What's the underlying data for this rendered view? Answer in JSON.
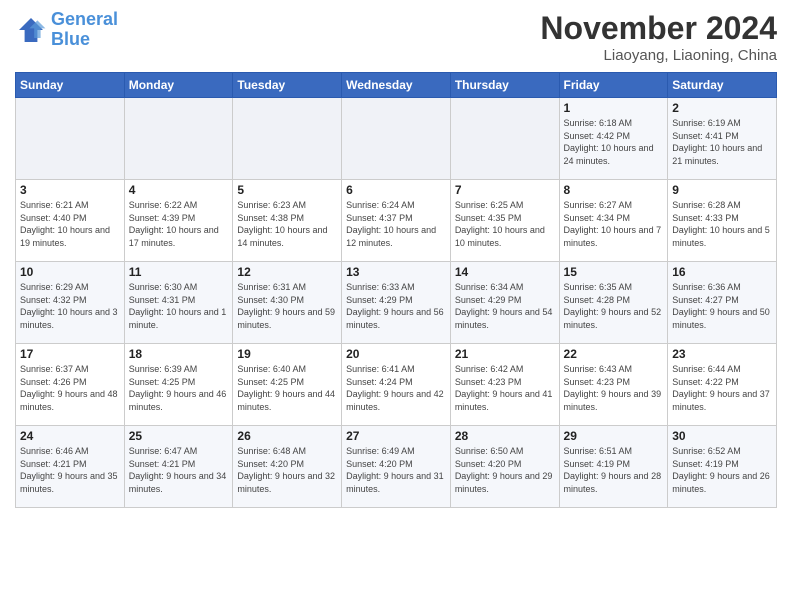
{
  "header": {
    "logo_line1": "General",
    "logo_line2": "Blue",
    "month": "November 2024",
    "location": "Liaoyang, Liaoning, China"
  },
  "weekdays": [
    "Sunday",
    "Monday",
    "Tuesday",
    "Wednesday",
    "Thursday",
    "Friday",
    "Saturday"
  ],
  "weeks": [
    [
      {
        "day": "",
        "info": ""
      },
      {
        "day": "",
        "info": ""
      },
      {
        "day": "",
        "info": ""
      },
      {
        "day": "",
        "info": ""
      },
      {
        "day": "",
        "info": ""
      },
      {
        "day": "1",
        "info": "Sunrise: 6:18 AM\nSunset: 4:42 PM\nDaylight: 10 hours and 24 minutes."
      },
      {
        "day": "2",
        "info": "Sunrise: 6:19 AM\nSunset: 4:41 PM\nDaylight: 10 hours and 21 minutes."
      }
    ],
    [
      {
        "day": "3",
        "info": "Sunrise: 6:21 AM\nSunset: 4:40 PM\nDaylight: 10 hours and 19 minutes."
      },
      {
        "day": "4",
        "info": "Sunrise: 6:22 AM\nSunset: 4:39 PM\nDaylight: 10 hours and 17 minutes."
      },
      {
        "day": "5",
        "info": "Sunrise: 6:23 AM\nSunset: 4:38 PM\nDaylight: 10 hours and 14 minutes."
      },
      {
        "day": "6",
        "info": "Sunrise: 6:24 AM\nSunset: 4:37 PM\nDaylight: 10 hours and 12 minutes."
      },
      {
        "day": "7",
        "info": "Sunrise: 6:25 AM\nSunset: 4:35 PM\nDaylight: 10 hours and 10 minutes."
      },
      {
        "day": "8",
        "info": "Sunrise: 6:27 AM\nSunset: 4:34 PM\nDaylight: 10 hours and 7 minutes."
      },
      {
        "day": "9",
        "info": "Sunrise: 6:28 AM\nSunset: 4:33 PM\nDaylight: 10 hours and 5 minutes."
      }
    ],
    [
      {
        "day": "10",
        "info": "Sunrise: 6:29 AM\nSunset: 4:32 PM\nDaylight: 10 hours and 3 minutes."
      },
      {
        "day": "11",
        "info": "Sunrise: 6:30 AM\nSunset: 4:31 PM\nDaylight: 10 hours and 1 minute."
      },
      {
        "day": "12",
        "info": "Sunrise: 6:31 AM\nSunset: 4:30 PM\nDaylight: 9 hours and 59 minutes."
      },
      {
        "day": "13",
        "info": "Sunrise: 6:33 AM\nSunset: 4:29 PM\nDaylight: 9 hours and 56 minutes."
      },
      {
        "day": "14",
        "info": "Sunrise: 6:34 AM\nSunset: 4:29 PM\nDaylight: 9 hours and 54 minutes."
      },
      {
        "day": "15",
        "info": "Sunrise: 6:35 AM\nSunset: 4:28 PM\nDaylight: 9 hours and 52 minutes."
      },
      {
        "day": "16",
        "info": "Sunrise: 6:36 AM\nSunset: 4:27 PM\nDaylight: 9 hours and 50 minutes."
      }
    ],
    [
      {
        "day": "17",
        "info": "Sunrise: 6:37 AM\nSunset: 4:26 PM\nDaylight: 9 hours and 48 minutes."
      },
      {
        "day": "18",
        "info": "Sunrise: 6:39 AM\nSunset: 4:25 PM\nDaylight: 9 hours and 46 minutes."
      },
      {
        "day": "19",
        "info": "Sunrise: 6:40 AM\nSunset: 4:25 PM\nDaylight: 9 hours and 44 minutes."
      },
      {
        "day": "20",
        "info": "Sunrise: 6:41 AM\nSunset: 4:24 PM\nDaylight: 9 hours and 42 minutes."
      },
      {
        "day": "21",
        "info": "Sunrise: 6:42 AM\nSunset: 4:23 PM\nDaylight: 9 hours and 41 minutes."
      },
      {
        "day": "22",
        "info": "Sunrise: 6:43 AM\nSunset: 4:23 PM\nDaylight: 9 hours and 39 minutes."
      },
      {
        "day": "23",
        "info": "Sunrise: 6:44 AM\nSunset: 4:22 PM\nDaylight: 9 hours and 37 minutes."
      }
    ],
    [
      {
        "day": "24",
        "info": "Sunrise: 6:46 AM\nSunset: 4:21 PM\nDaylight: 9 hours and 35 minutes."
      },
      {
        "day": "25",
        "info": "Sunrise: 6:47 AM\nSunset: 4:21 PM\nDaylight: 9 hours and 34 minutes."
      },
      {
        "day": "26",
        "info": "Sunrise: 6:48 AM\nSunset: 4:20 PM\nDaylight: 9 hours and 32 minutes."
      },
      {
        "day": "27",
        "info": "Sunrise: 6:49 AM\nSunset: 4:20 PM\nDaylight: 9 hours and 31 minutes."
      },
      {
        "day": "28",
        "info": "Sunrise: 6:50 AM\nSunset: 4:20 PM\nDaylight: 9 hours and 29 minutes."
      },
      {
        "day": "29",
        "info": "Sunrise: 6:51 AM\nSunset: 4:19 PM\nDaylight: 9 hours and 28 minutes."
      },
      {
        "day": "30",
        "info": "Sunrise: 6:52 AM\nSunset: 4:19 PM\nDaylight: 9 hours and 26 minutes."
      }
    ]
  ]
}
